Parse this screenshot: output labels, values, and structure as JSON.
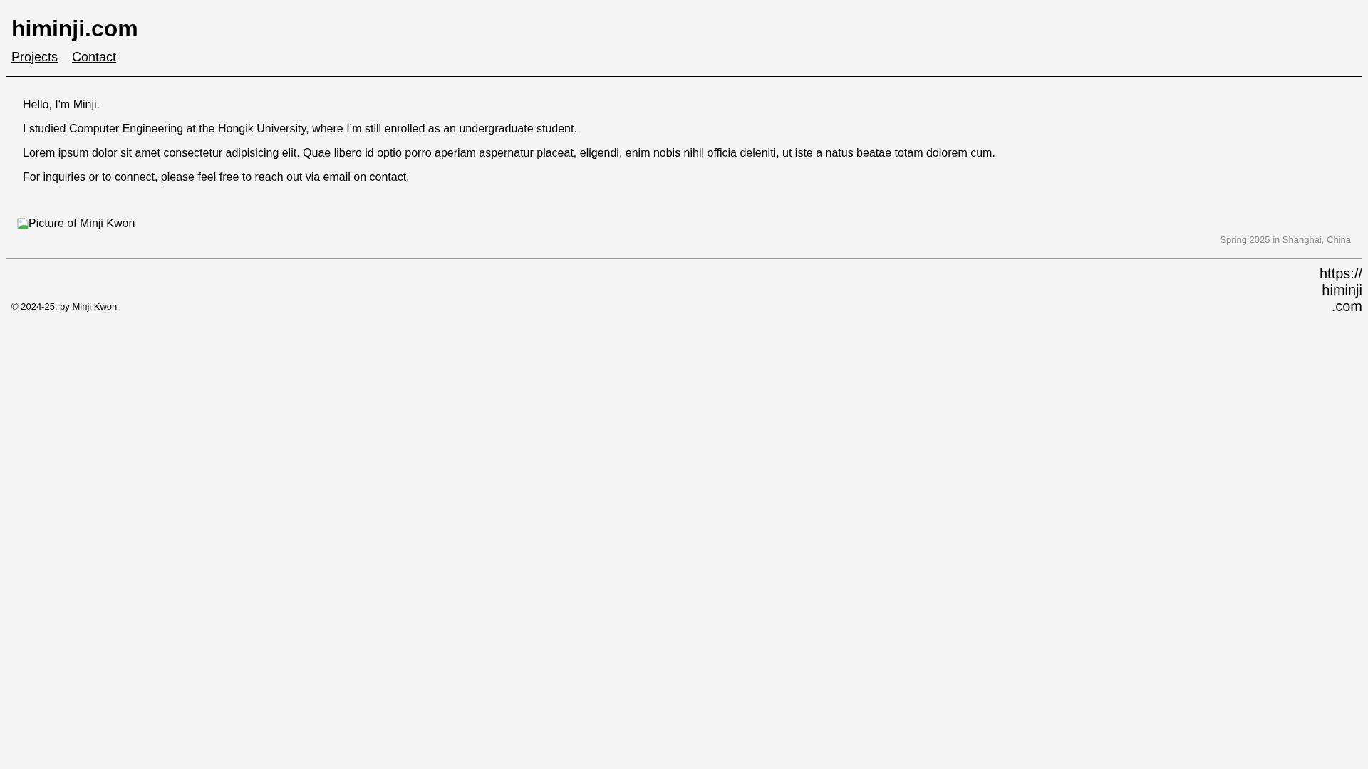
{
  "header": {
    "title": "himinji.com",
    "nav": [
      {
        "label": "Projects"
      },
      {
        "label": "Contact"
      }
    ]
  },
  "intro": [
    {
      "text": "Hello, I'm Minji."
    },
    {
      "text": "I studied Computer Engineering at the Hongik University, where I’m still enrolled as an undergraduate student."
    },
    {
      "text": "Lorem ipsum dolor sit amet consectetur adipisicing elit. Quae libero id optio porro aperiam aspernatur placeat, eligendi, enim nobis nihil officia deleniti, ut iste a natus beatae totam dolorem cum."
    },
    {
      "text": "For inquiries or to connect, please feel free to reach out via email on ",
      "link": "contact",
      "after": "."
    }
  ],
  "photo": {
    "alt": "Picture of Minji Kwon",
    "caption": "Spring 2025 in Shanghai, China"
  },
  "footer": {
    "copyright": "© 2024-25, by Minji Kwon",
    "url_lines": [
      "https://",
      "himinji",
      ".com"
    ]
  }
}
